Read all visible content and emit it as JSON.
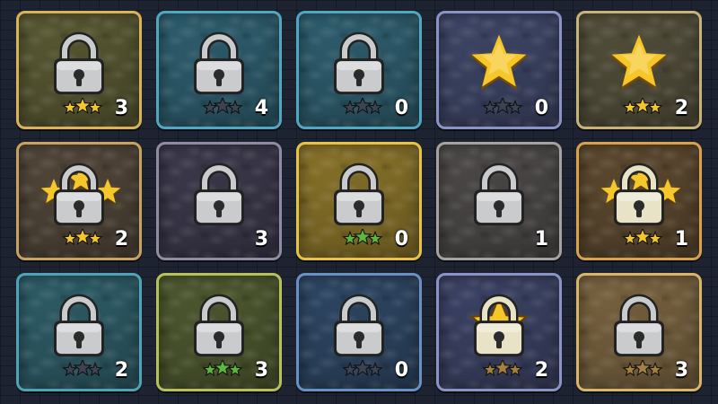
{
  "tiles": [
    {
      "theme": "olive",
      "border": "#d9b25a",
      "bg": "#5a5a34",
      "icon": "lock",
      "star_style": "gold",
      "count": "3"
    },
    {
      "theme": "teal",
      "border": "#4fa7c2",
      "bg": "#2f5f70",
      "icon": "lock",
      "star_style": "dark",
      "count": "4"
    },
    {
      "theme": "teal",
      "border": "#4fa7c2",
      "bg": "#2f5f70",
      "icon": "lock",
      "star_style": "dark",
      "count": "0"
    },
    {
      "theme": "slate",
      "border": "#8a93c6",
      "bg": "#3f4768",
      "icon": "gold-star",
      "star_style": "dark",
      "count": "0"
    },
    {
      "theme": "stone",
      "border": "#c7b37a",
      "bg": "#54503c",
      "icon": "gold-star",
      "star_style": "gold",
      "count": "2"
    },
    {
      "theme": "stone",
      "border": "#c9a262",
      "bg": "#52473a",
      "icon": "lock-with-stars",
      "star_style": "gold",
      "count": "2"
    },
    {
      "theme": "purple",
      "border": "#8e8ba3",
      "bg": "#3d3a4d",
      "icon": "lock",
      "star_style": "none",
      "count": "3"
    },
    {
      "theme": "yellow",
      "border": "#e6c24a",
      "bg": "#8a742a",
      "icon": "lock",
      "star_style": "green",
      "count": "0"
    },
    {
      "theme": "grey",
      "border": "#a7a2a0",
      "bg": "#4e4a4a",
      "icon": "lock",
      "star_style": "none",
      "count": "1"
    },
    {
      "theme": "amber",
      "border": "#d8a14a",
      "bg": "#5e4a30",
      "icon": "lock-with-stars-cream",
      "star_style": "gold",
      "count": "1"
    },
    {
      "theme": "teal",
      "border": "#4ea3b6",
      "bg": "#2f5e69",
      "icon": "lock",
      "star_style": "dark",
      "count": "2"
    },
    {
      "theme": "olive",
      "border": "#b5c25a",
      "bg": "#4f5a30",
      "icon": "lock",
      "star_style": "green",
      "count": "3"
    },
    {
      "theme": "blue",
      "border": "#6a8fc4",
      "bg": "#2f4866",
      "icon": "lock",
      "star_style": "dark",
      "count": "0"
    },
    {
      "theme": "slate",
      "border": "#8a93c6",
      "bg": "#3d4466",
      "icon": "lock-with-star-cream",
      "star_style": "bronze",
      "count": "2"
    },
    {
      "theme": "sand",
      "border": "#d9b56a",
      "bg": "#7a6440",
      "icon": "lock",
      "star_style": "bronze",
      "count": "3"
    }
  ],
  "colors": {
    "lock_silver": "#c9cbcd",
    "lock_cream": "#e8e2c6",
    "star_gold": "#f5c72a",
    "star_green": "#5cb83a",
    "star_bronze": "#a6803e",
    "star_dark": "#3c4352"
  }
}
